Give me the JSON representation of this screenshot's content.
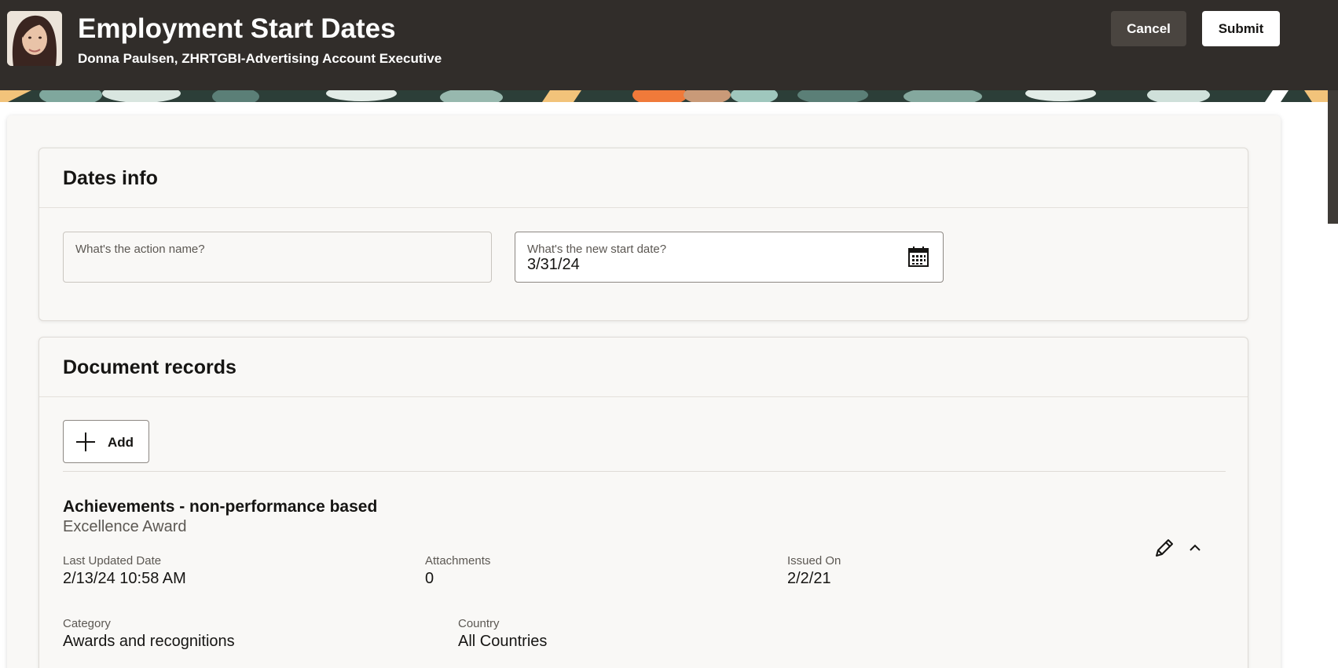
{
  "header": {
    "title": "Employment Start Dates",
    "subtitle": "Donna Paulsen, ZHRTGBI-Advertising Account Executive",
    "cancel_label": "Cancel",
    "submit_label": "Submit",
    "background_color": "#312d2a"
  },
  "dates_section": {
    "title": "Dates info",
    "action_name_label": "What's the action name?",
    "action_name_value": "",
    "start_date_label": "What's the new start date?",
    "start_date_value": "3/31/24",
    "calendar_icon": "calendar-icon"
  },
  "documents_section": {
    "title": "Document records",
    "add_label": "Add",
    "record": {
      "title": "Achievements - non-performance based",
      "subtitle": "Excellence Award",
      "fields": {
        "last_updated_label": "Last Updated Date",
        "last_updated_value": "2/13/24 10:58 AM",
        "attachments_label": "Attachments",
        "attachments_value": "0",
        "issued_on_label": "Issued On",
        "issued_on_value": "2/2/21",
        "category_label": "Category",
        "category_value": "Awards and recognitions",
        "country_label": "Country",
        "country_value": "All Countries"
      },
      "edit_icon": "pencil-icon",
      "collapse_icon": "chevron-up-icon"
    }
  }
}
